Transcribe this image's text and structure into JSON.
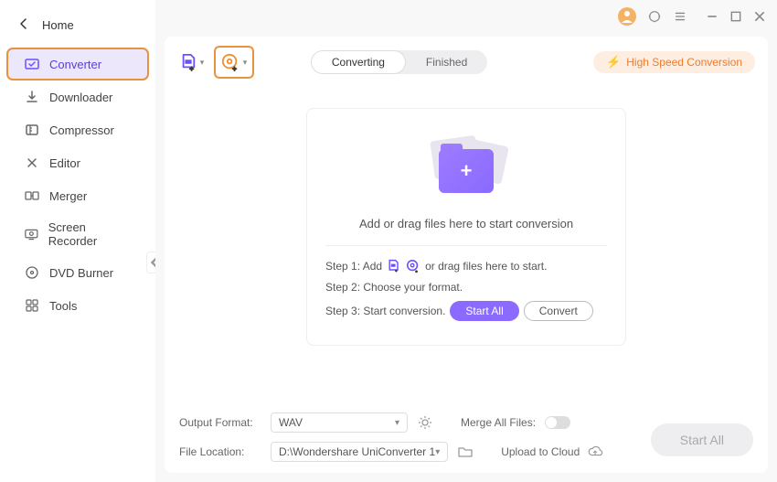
{
  "titlebar": {
    "home": "Home"
  },
  "sidebar": {
    "items": [
      {
        "label": "Converter"
      },
      {
        "label": "Downloader"
      },
      {
        "label": "Compressor"
      },
      {
        "label": "Editor"
      },
      {
        "label": "Merger"
      },
      {
        "label": "Screen Recorder"
      },
      {
        "label": "DVD Burner"
      },
      {
        "label": "Tools"
      }
    ]
  },
  "tabs": {
    "converting": "Converting",
    "finished": "Finished"
  },
  "speed_badge": "High Speed Conversion",
  "dropzone": {
    "caption": "Add or drag files here to start conversion",
    "step1_a": "Step 1: Add",
    "step1_b": "or drag files here to start.",
    "step2": "Step 2: Choose your format.",
    "step3": "Step 3: Start conversion.",
    "start_all": "Start All",
    "convert": "Convert"
  },
  "footer": {
    "output_label": "Output Format:",
    "output_value": "WAV",
    "location_label": "File Location:",
    "location_value": "D:\\Wondershare UniConverter 1",
    "merge_label": "Merge All Files:",
    "cloud_label": "Upload to Cloud",
    "start_all": "Start All"
  }
}
